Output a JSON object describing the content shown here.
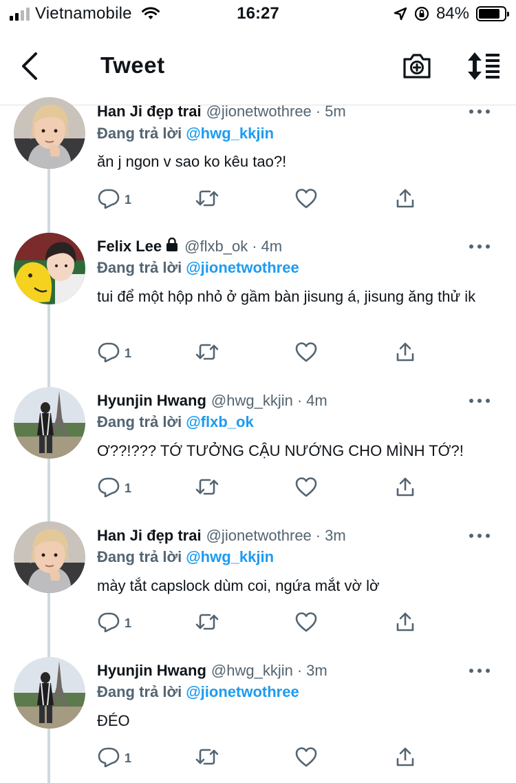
{
  "status_bar": {
    "carrier": "Vietnamobile",
    "time": "16:27",
    "battery": "84%",
    "battery_level": 0.84
  },
  "nav": {
    "title": "Tweet"
  },
  "reply_prefix": "Đang trả lời",
  "colors": {
    "accent": "#1d9bf0",
    "secondary_text": "#536471",
    "thread_line": "#cfd9de"
  },
  "tweets": [
    {
      "name": "Han Ji đẹp trai",
      "handle": "@jionetwothree",
      "dot": "·",
      "time": "5m",
      "reply_to": "@hwg_kkjin",
      "text": "ăn j ngon v sao ko kêu tao?!",
      "reply_count": "1",
      "avatar": "blonde-avatar"
    },
    {
      "name": "Felix Lee",
      "locked": true,
      "handle": "@flxb_ok",
      "dot": "·",
      "time": "4m",
      "reply_to": "@jionetwothree",
      "text": "tui để một hộp nhỏ ở gầm bàn jisung á, jisung ăng thử ik",
      "reply_count": "1",
      "avatar": "yellow-plush-avatar"
    },
    {
      "name": "Hyunjin Hwang",
      "handle": "@hwg_kkjin",
      "dot": "·",
      "time": "4m",
      "reply_to": "@flxb_ok",
      "text": "Ơ??!??? TỚ TƯỞNG CẬU NƯỚNG CHO MÌNH TỚ?!",
      "reply_count": "1",
      "avatar": "eiffel-avatar"
    },
    {
      "name": "Han Ji đẹp trai",
      "handle": "@jionetwothree",
      "dot": "·",
      "time": "3m",
      "reply_to": "@hwg_kkjin",
      "text": "mày tắt capslock dùm coi, ngứa mắt vờ lờ",
      "reply_count": "1",
      "avatar": "blonde-avatar"
    },
    {
      "name": "Hyunjin Hwang",
      "handle": "@hwg_kkjin",
      "dot": "·",
      "time": "3m",
      "reply_to": "@jionetwothree",
      "text": "ĐÉO",
      "reply_count": "1",
      "avatar": "eiffel-avatar"
    }
  ]
}
